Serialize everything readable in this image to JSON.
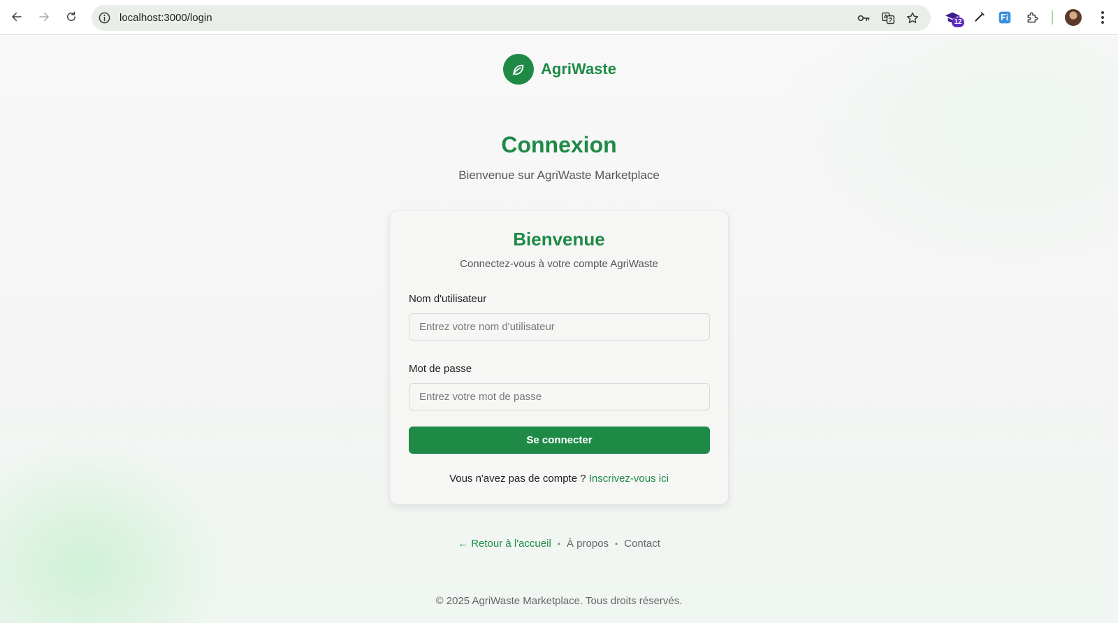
{
  "browser": {
    "url": "localhost:3000/login",
    "extension_badge": "12"
  },
  "brand": {
    "name": "AgriWaste"
  },
  "page": {
    "title": "Connexion",
    "subtitle": "Bienvenue sur AgriWaste Marketplace"
  },
  "card": {
    "title": "Bienvenue",
    "subtitle": "Connectez-vous à votre compte AgriWaste",
    "username_label": "Nom d'utilisateur",
    "username_placeholder": "Entrez votre nom d'utilisateur",
    "password_label": "Mot de passe",
    "password_placeholder": "Entrez votre mot de passe",
    "submit_label": "Se connecter",
    "signup_prompt": "Vous n'avez pas de compte ?",
    "signup_link": "Inscrivez-vous ici"
  },
  "links": {
    "back": "← Retour à l'accueil",
    "about": "À propos",
    "contact": "Contact",
    "separator": "•"
  },
  "footer": {
    "copyright": "© 2025 AgriWaste Marketplace. Tous droits réservés."
  },
  "colors": {
    "brand_green": "#1e8a46",
    "omnibox_bg": "#e9eee9",
    "badge_purple": "#5b2bbf"
  },
  "icons": {
    "back": "arrow-left-icon",
    "forward": "arrow-right-icon",
    "reload": "reload-icon",
    "site_info": "info-circle-icon",
    "password": "key-icon",
    "translate": "translate-icon",
    "bookmark": "star-icon",
    "extension_mortarboard": "graduation-cap-icon",
    "extension_pen": "pen-icon",
    "extension_fi": "fi-icon",
    "extensions": "puzzle-icon",
    "menu": "more-vertical-icon",
    "logo": "leaf-icon"
  }
}
